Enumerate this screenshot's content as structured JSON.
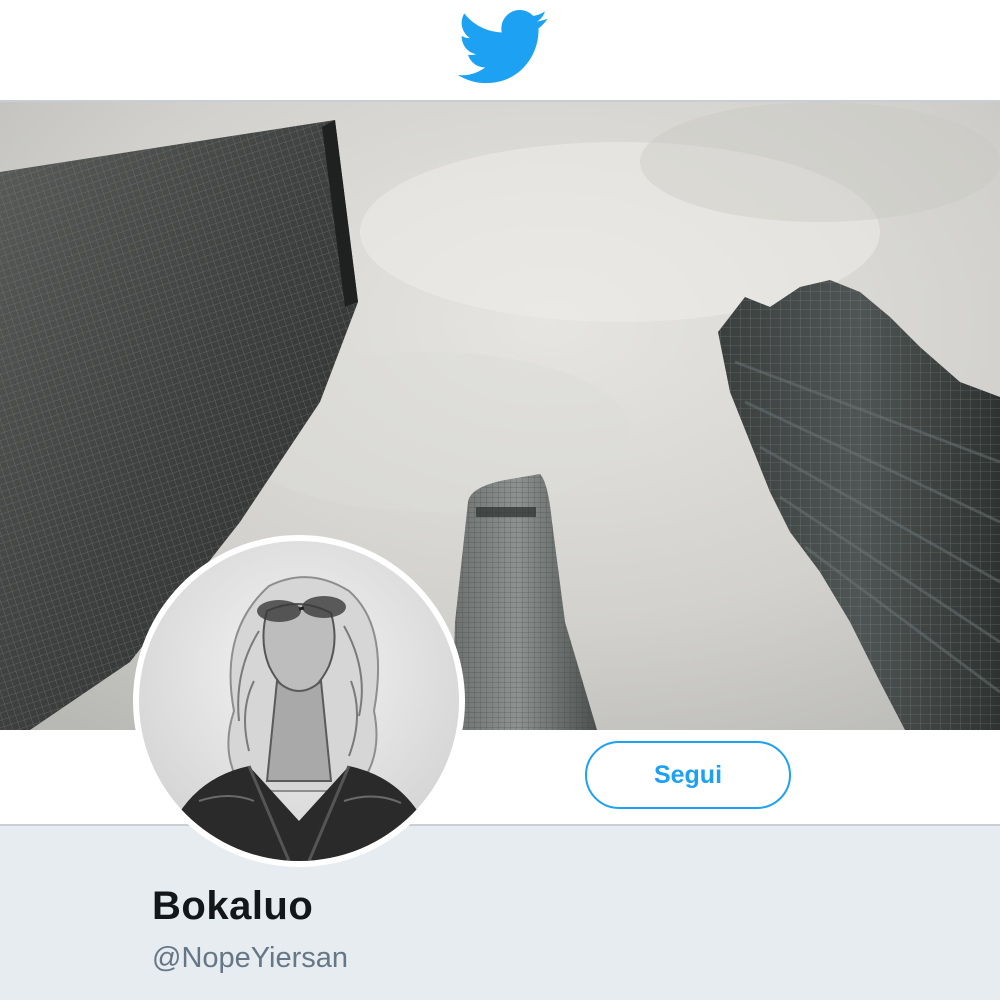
{
  "header": {
    "logo_icon": "twitter-bird-icon",
    "logo_color": "#1da1f2"
  },
  "banner": {
    "description_icon": "skyscrapers-photo"
  },
  "profile": {
    "avatar_icon": "profile-photo",
    "display_name": "Bokaluo",
    "handle": "@NopeYiersan",
    "follow_label": "Segui"
  },
  "colors": {
    "accent": "#1da1f2",
    "info_bg": "#e6ecf0",
    "name_text": "#14171a",
    "handle_text": "#657786"
  }
}
